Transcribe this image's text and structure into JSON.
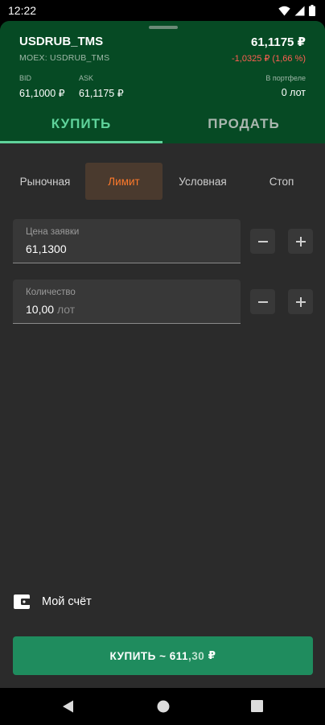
{
  "status_bar": {
    "time": "12:22"
  },
  "instrument": {
    "ticker": "USDRUB_TMS",
    "exchange": "MOEX: USDRUB_TMS",
    "price": "61,1175 ₽",
    "change": "-1,0325 ₽ (1,66 %)",
    "bid_label": "BID",
    "bid_value": "61,1000 ₽",
    "ask_label": "ASK",
    "ask_value": "61,1175 ₽",
    "portfolio_label": "В портфеле",
    "portfolio_value": "0 лот"
  },
  "tabs": {
    "buy": "КУПИТЬ",
    "sell": "ПРОДАТЬ",
    "active": "buy"
  },
  "order_types": [
    {
      "label": "Рыночная",
      "active": false
    },
    {
      "label": "Лимит",
      "active": true
    },
    {
      "label": "Условная",
      "active": false
    },
    {
      "label": "Стоп",
      "active": false
    }
  ],
  "order_price": {
    "label": "Цена заявки",
    "value": "61,1300"
  },
  "quantity": {
    "label": "Количество",
    "value": "10,00",
    "unit": "лот"
  },
  "account": {
    "label": "Мой счёт",
    "icon": "wallet-icon"
  },
  "submit": {
    "prefix": "КУПИТЬ ~ 611",
    "decimal": ",30",
    "suffix": " ₽"
  },
  "colors": {
    "header_bg": "#064a24",
    "accent_green": "#5fd39b",
    "negative_red": "#ff5f52",
    "limit_orange": "#ff7a2b",
    "buy_button": "#1f8c5e"
  }
}
